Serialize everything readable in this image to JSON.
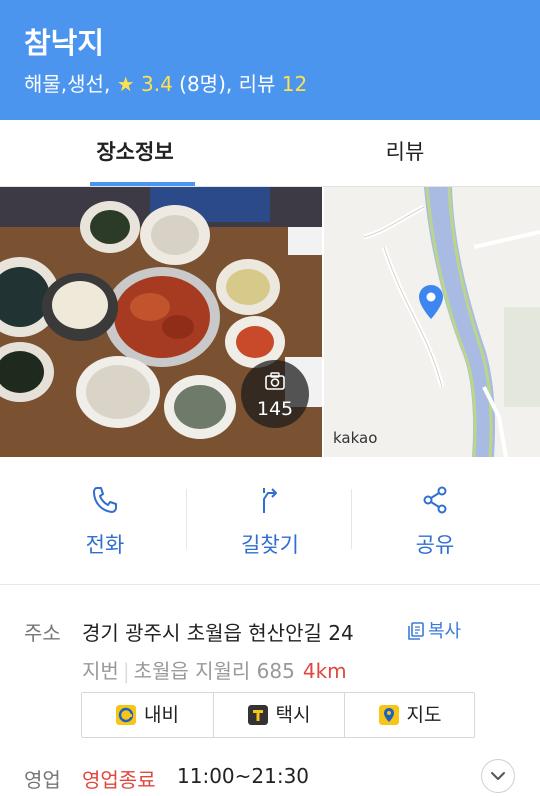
{
  "header": {
    "title": "참낙지",
    "category": "해물,생선,",
    "star_icon": "★",
    "rating": "3.4",
    "rating_count": "(8명),",
    "review_label": "리뷰",
    "review_count": "12"
  },
  "tabs": [
    {
      "label": "장소정보",
      "active": true
    },
    {
      "label": "리뷰",
      "active": false
    }
  ],
  "photo": {
    "count": "145",
    "icon": "camera-icon"
  },
  "map": {
    "label": "kakao",
    "icon": "location-pin-icon"
  },
  "actions": [
    {
      "label": "전화",
      "icon": "phone-icon"
    },
    {
      "label": "길찾기",
      "icon": "directions-icon"
    },
    {
      "label": "공유",
      "icon": "share-icon"
    }
  ],
  "address": {
    "label": "주소",
    "value": "경기 광주시 초월읍 현산안길 24",
    "copy_label": "복사",
    "jibun_label": "지번",
    "jibun_value": "초월읍 지월리 685",
    "distance": "4km"
  },
  "service_buttons": [
    {
      "label": "내비",
      "icon": "navi-icon",
      "color": "#f5c518"
    },
    {
      "label": "택시",
      "icon": "taxi-icon",
      "color": "#333333"
    },
    {
      "label": "지도",
      "icon": "map-pin-icon",
      "color": "#f5c518"
    }
  ],
  "hours": {
    "label": "영업",
    "status": "영업종료",
    "time": "11:00~21:30"
  },
  "colors": {
    "accent": "#4b95ef",
    "link": "#2f6fd1",
    "alert": "#e0483e",
    "star": "#ffe14d"
  }
}
